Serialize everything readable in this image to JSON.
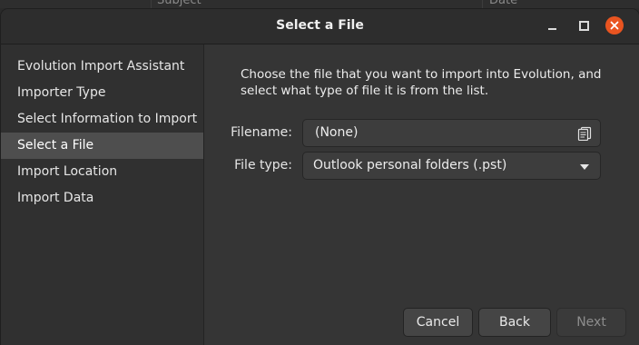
{
  "background_app": {
    "subject_header": "Subject",
    "date_header": "Date"
  },
  "dialog": {
    "title": "Select a File",
    "window_controls": {
      "minimize_icon": "minimize-icon",
      "maximize_icon": "maximize-icon",
      "close_icon": "close-icon",
      "close_color": "#e95420"
    }
  },
  "sidebar": {
    "items": [
      {
        "label": "Evolution Import Assistant",
        "active": false
      },
      {
        "label": "Importer Type",
        "active": false
      },
      {
        "label": "Select Information to Import",
        "active": false
      },
      {
        "label": "Select a File",
        "active": true
      },
      {
        "label": "Import Location",
        "active": false
      },
      {
        "label": "Import Data",
        "active": false
      }
    ]
  },
  "main": {
    "instructions_line1": "Choose the file that you want to import into Evolution, and",
    "instructions_line2": "select what type of file it is from the list.",
    "filename_label": "Filename:",
    "filename_value": "(None)",
    "filetype_label": "File type:",
    "filetype_value": "Outlook personal folders (.pst)"
  },
  "buttons": {
    "cancel": "Cancel",
    "back": "Back",
    "next": "Next"
  }
}
